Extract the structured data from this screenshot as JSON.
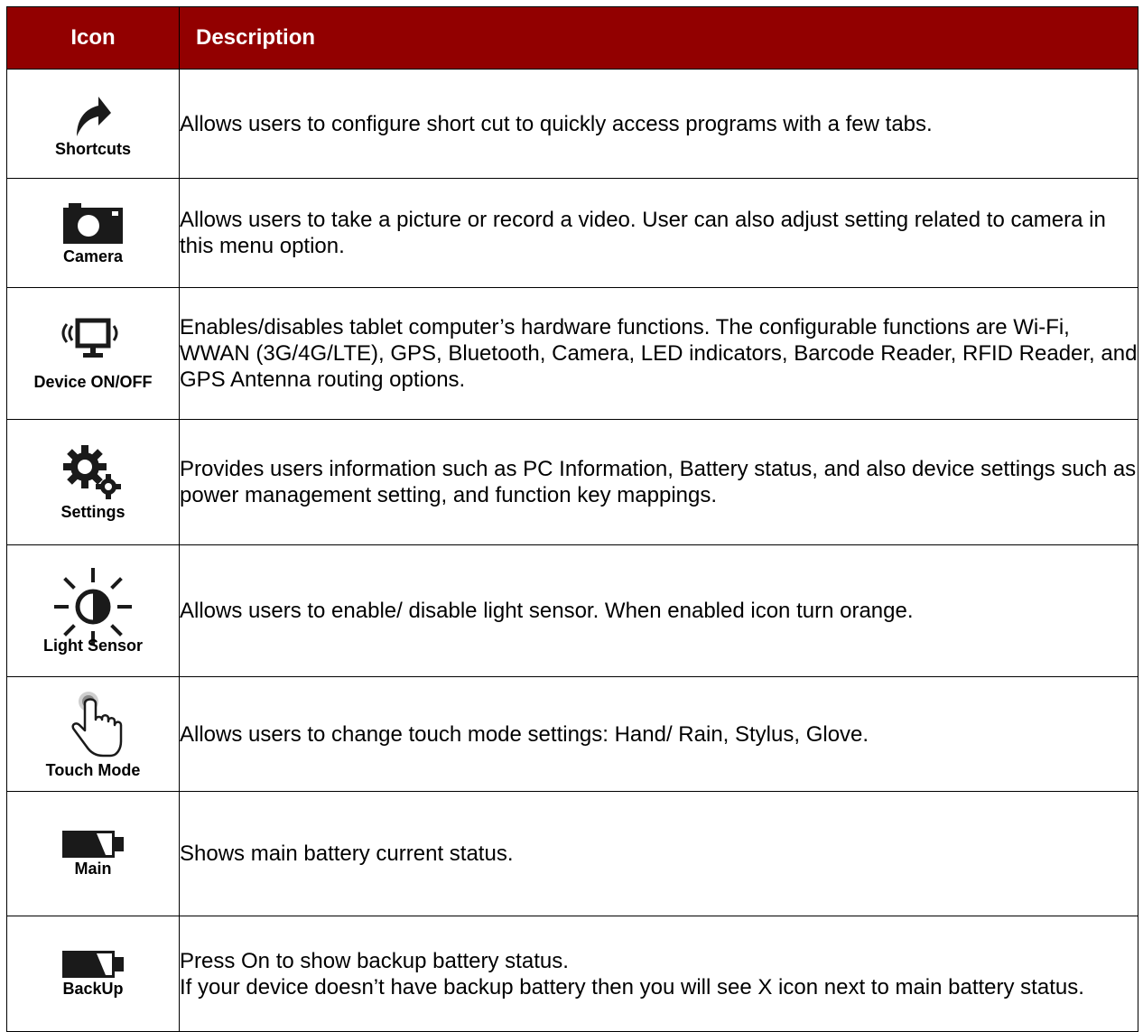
{
  "table": {
    "header": {
      "icon": "Icon",
      "description": "Description"
    },
    "rows": [
      {
        "icon": "shortcut-arrow-icon",
        "label": "Shortcuts",
        "description": "Allows users to configure short cut to quickly access programs with a few tabs."
      },
      {
        "icon": "camera-icon",
        "label": "Camera",
        "description": "Allows users to take a picture or record a video. User can also adjust setting related to camera in this menu option."
      },
      {
        "icon": "monitor-wireless-icon",
        "label": "Device ON/OFF",
        "description": "Enables/disables tablet computer’s hardware functions. The configurable functions are Wi-Fi, WWAN (3G/4G/LTE), GPS, Bluetooth, Camera, LED indicators, Barcode Reader, RFID Reader, and GPS Antenna routing options."
      },
      {
        "icon": "gears-icon",
        "label": "Settings",
        "description": "Provides users information such as PC Information, Battery status, and also device settings such as power management setting, and function key mappings."
      },
      {
        "icon": "light-sensor-icon",
        "label": "Light Sensor",
        "description": "Allows users to enable/ disable light sensor. When enabled icon turn orange."
      },
      {
        "icon": "touch-hand-icon",
        "label": "Touch Mode",
        "description": "Allows users to change touch mode settings: Hand/ Rain, Stylus, Glove."
      },
      {
        "icon": "battery-icon",
        "label": "Main",
        "description": "Shows main battery current status."
      },
      {
        "icon": "battery-icon",
        "label": "BackUp",
        "description_lines": [
          "Press On to show backup battery status.",
          "If your device doesn’t have backup battery then you will see X icon next to main battery status."
        ]
      }
    ]
  },
  "colors": {
    "header_background": "#920000",
    "header_text": "#ffffff"
  }
}
